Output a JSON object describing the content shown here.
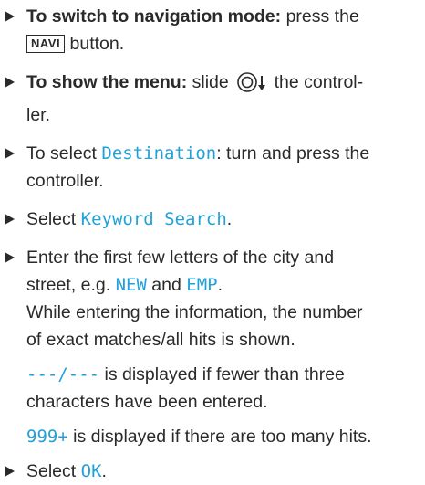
{
  "steps": [
    {
      "bold": "To switch to navigation mode:",
      "rest_before": " press the ",
      "key": "NAVI",
      "rest_after": " button."
    },
    {
      "bold": "To show the menu:",
      "rest_before": " slide ",
      "rest_after": " the control-",
      "rest_after2": "ler."
    },
    {
      "before": "To select ",
      "display": "Destination",
      "after": ": turn and press the",
      "after2": "controller."
    },
    {
      "before": "Select ",
      "display": "Keyword Search",
      "after": "."
    },
    {
      "line1": "Enter the first few letters of the city and",
      "line2_before": "street, e.g. ",
      "display1": "NEW",
      "mid": " and ",
      "display2": "EMP",
      "line2_end": ".",
      "line3": "While entering the information, the number",
      "line4": "of exact matches/all hits is shown."
    }
  ],
  "notes": [
    {
      "display": "---/---",
      "after": " is displayed if fewer than three",
      "after2": "characters have been entered."
    },
    {
      "display": "999+",
      "after": " is displayed if there are too many hits."
    }
  ],
  "final_step": {
    "before": "Select ",
    "display": "OK",
    "after": "."
  },
  "icons": {
    "bullet": "triangle-right-icon",
    "controller": "controller-slide-down-icon"
  },
  "colors": {
    "display_text": "#22a0d8",
    "body_text": "#2a2a2a"
  }
}
